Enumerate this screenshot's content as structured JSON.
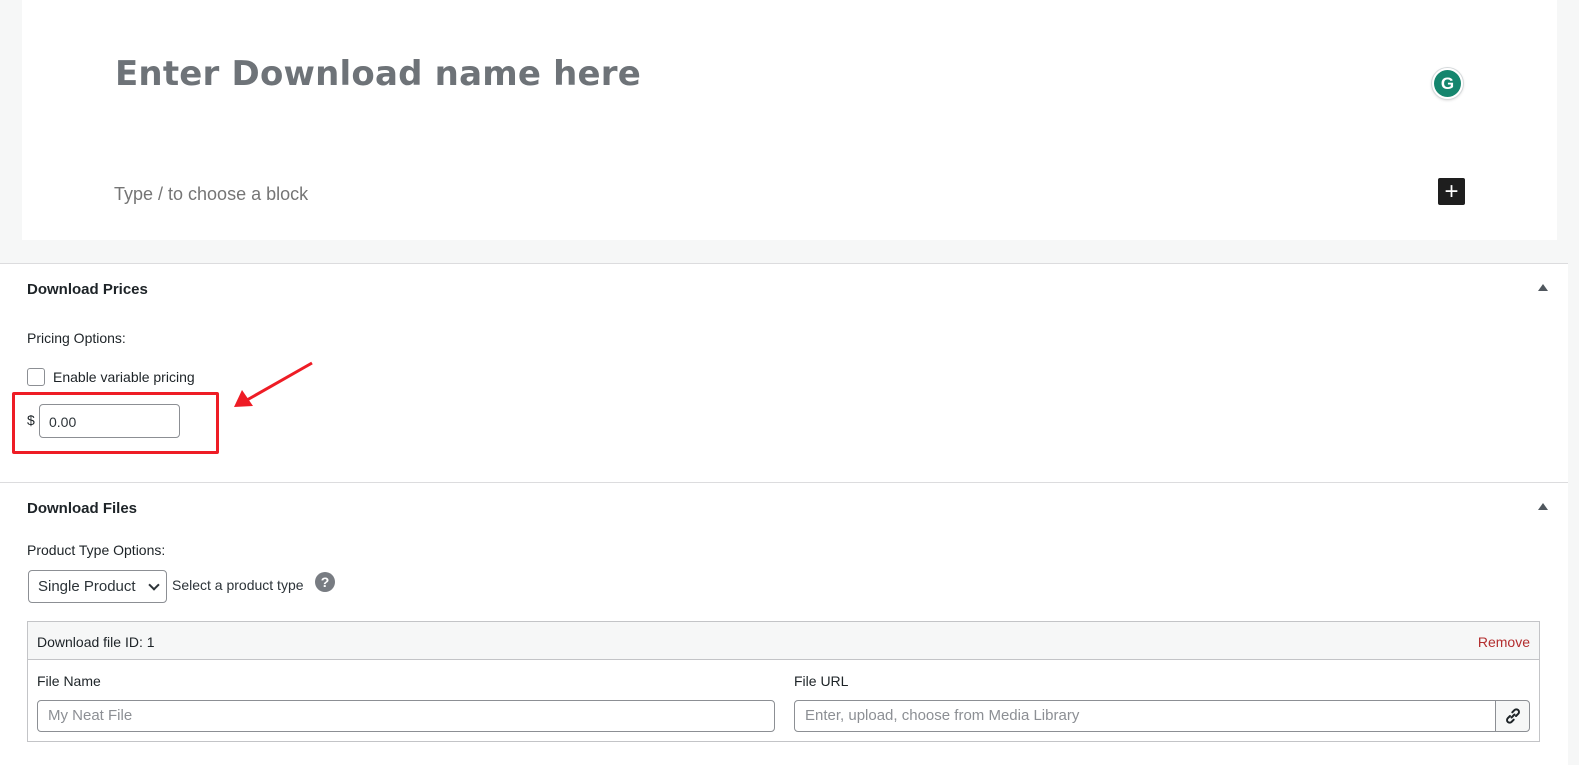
{
  "editor": {
    "title_placeholder": "Enter Download name here",
    "block_prompt": "Type / to choose a block",
    "add_block_symbol": "+",
    "grammarly_letter": "G"
  },
  "prices": {
    "title": "Download Prices",
    "pricing_options_label": "Pricing Options:",
    "variable_pricing_label": "Enable variable pricing",
    "variable_pricing_checked": false,
    "currency_symbol": "$",
    "price_value": "0.00",
    "highlight_color": "#ee1c25"
  },
  "files": {
    "title": "Download Files",
    "product_type_label": "Product Type Options:",
    "product_type_selected": "Single Product",
    "product_type_help": "Select a product type",
    "help_symbol": "?",
    "file_row": {
      "id_label": "Download file ID: 1",
      "remove_label": "Remove",
      "file_name_label": "File Name",
      "file_name_placeholder": "My Neat File",
      "file_url_label": "File URL",
      "file_url_placeholder": "Enter, upload, choose from Media Library"
    }
  }
}
